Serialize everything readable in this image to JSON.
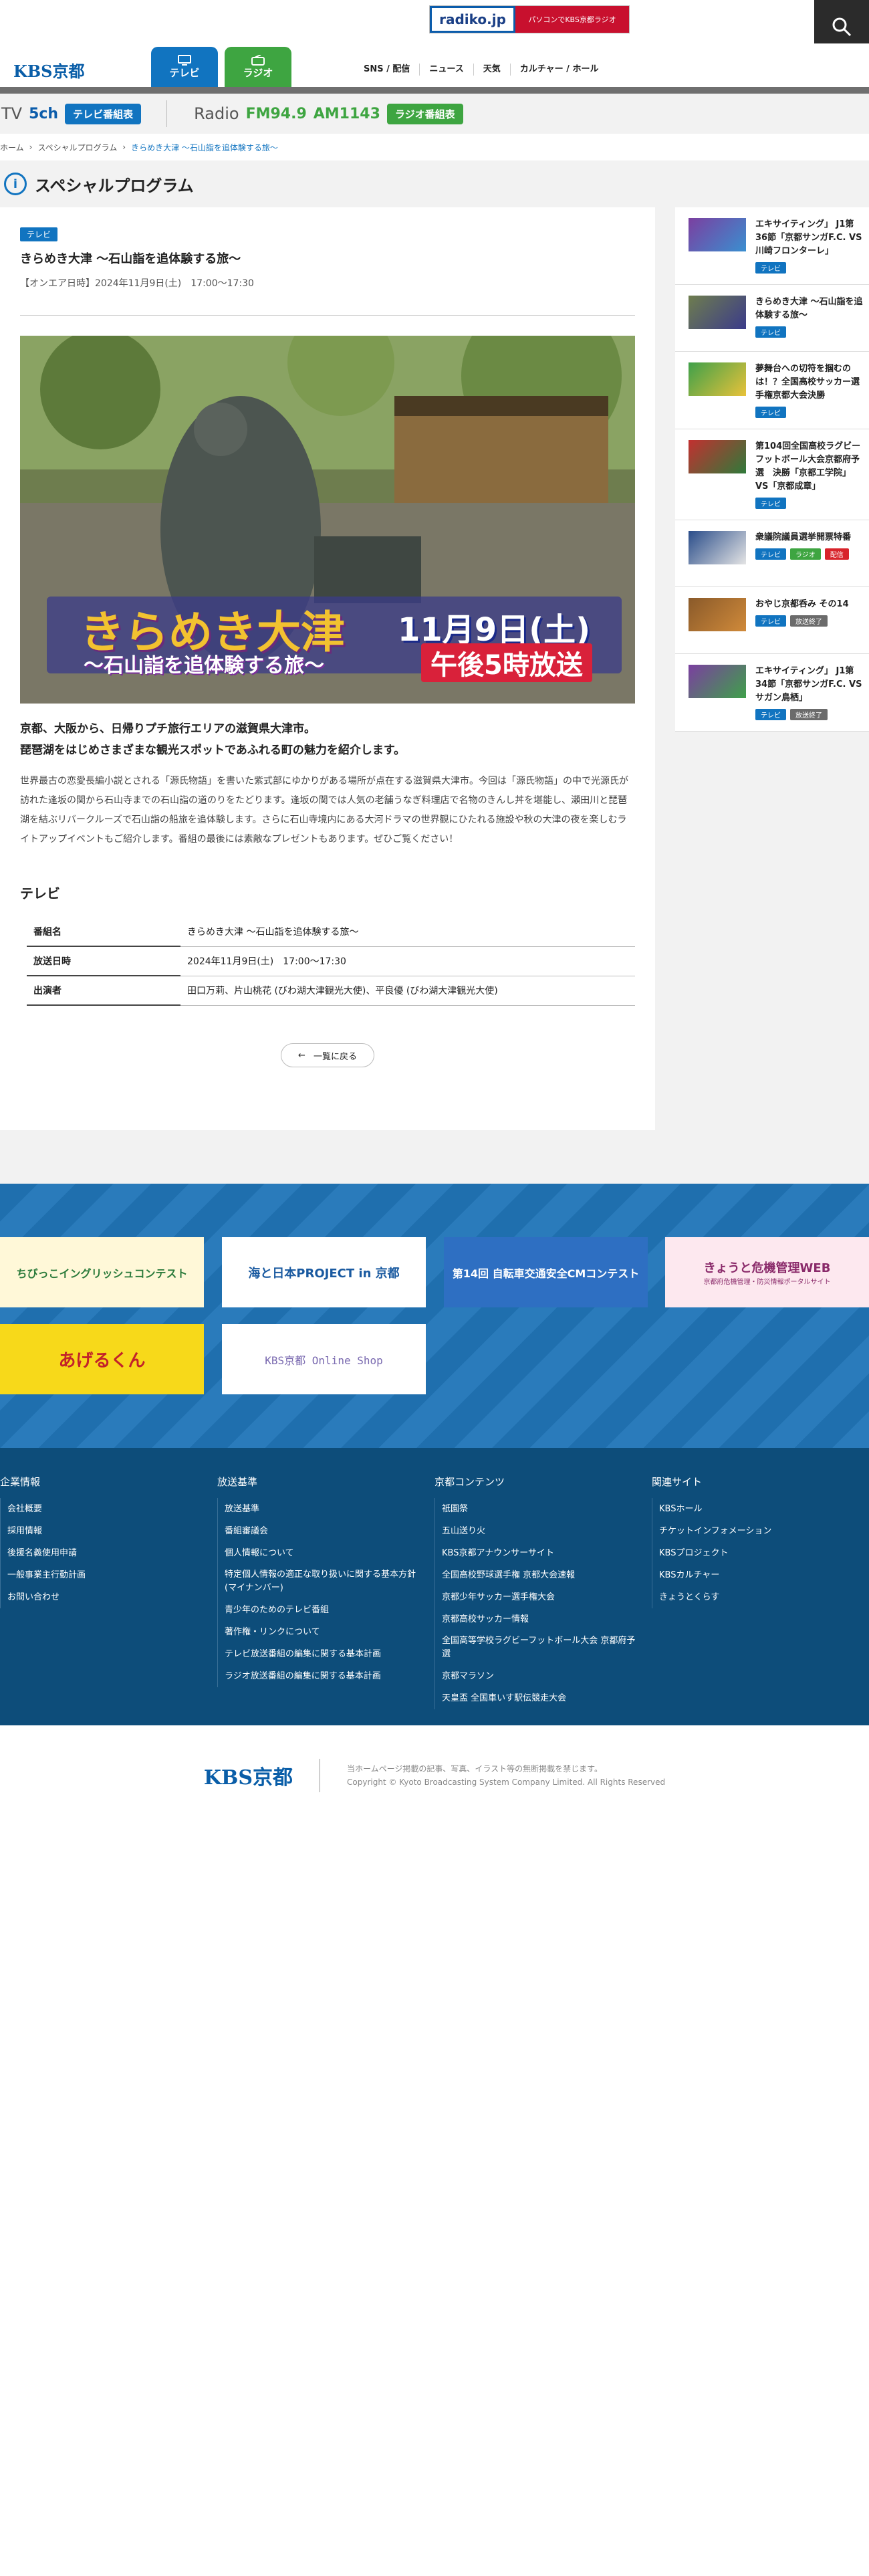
{
  "topbar": {
    "radiko_logo": "radiko.jp",
    "radiko_text": "パソコンでKBS京都ラジオ"
  },
  "header": {
    "logo": "KBS京都",
    "tab_tv": "テレビ",
    "tab_radio": "ラジオ",
    "nav": [
      "SNS / 配信",
      "ニュース",
      "天気",
      "カルチャー / ホール"
    ]
  },
  "channels": {
    "tv_label": "TV",
    "tv_ch": "5ch",
    "tv_button": "テレビ番組表",
    "radio_label": "Radio",
    "fm": "FM94.9",
    "am": "AM1143",
    "radio_button": "ラジオ番組表"
  },
  "breadcrumb": {
    "home": "ホーム",
    "section": "スペシャルプログラム",
    "current": "きらめき大津 〜石山詣を追体験する旅〜"
  },
  "page_title": "スペシャルプログラム",
  "article": {
    "badge": "テレビ",
    "title": "きらめき大津 〜石山詣を追体験する旅〜",
    "date": "【オンエア日時】2024年11月9日(土)　17:00〜17:30",
    "hero_title": "きらめき大津",
    "hero_sub": "〜石山詣を追体験する旅〜",
    "hero_date": "11月9日(土)",
    "hero_time": "午後5時放送",
    "lead1": "京都、大阪から、日帰りプチ旅行エリアの滋賀県大津市。",
    "lead2": "琵琶湖をはじめさまざまな観光スポットであふれる町の魅力を紹介します。",
    "body": "世界最古の恋愛長編小説とされる「源氏物語」を書いた紫式部にゆかりがある場所が点在する滋賀県大津市。今回は「源氏物語」の中で光源氏が訪れた逢坂の関から石山寺までの石山詣の道のりをたどります。逢坂の関では人気の老舗うなぎ料理店で名物のきんし丼を堪能し、瀬田川と琵琶湖を結ぶリバークルーズで石山詣の船旅を追体験します。さらに石山寺境内にある大河ドラマの世界観にひたれる施設や秋の大津の夜を楽しむライトアップイベントもご紹介します。番組の最後には素敵なプレゼントもあります。ぜひご覧ください！",
    "table_title": "テレビ",
    "rows": [
      {
        "k": "番組名",
        "v": "きらめき大津 〜石山詣を追体験する旅〜"
      },
      {
        "k": "放送日時",
        "v": "2024年11月9日(土)　17:00〜17:30"
      },
      {
        "k": "出演者",
        "v": "田口万莉、片山桃花 (びわ湖大津観光大使)、平良優 (びわ湖大津観光大使)"
      }
    ],
    "back": "一覧に戻る"
  },
  "sidebar": [
    {
      "title": "エキサイティング」 J1第36節「京都サンガF.C. VS 川崎フロンターレ」",
      "tags": [
        "テレビ"
      ]
    },
    {
      "title": "きらめき大津 〜石山詣を追体験する旅〜",
      "tags": [
        "テレビ"
      ]
    },
    {
      "title": "夢舞台への切符を掴むのは！？全国高校サッカー選手権京都大会決勝",
      "tags": [
        "テレビ"
      ]
    },
    {
      "title": "第104回全国高校ラグビーフットボール大会京都府予選　決勝「京都工学院」VS「京都成章」",
      "tags": [
        "テレビ"
      ]
    },
    {
      "title": "衆議院議員選挙開票特番",
      "tags": [
        "テレビ",
        "ラジオ",
        "配信"
      ]
    },
    {
      "title": "おやじ京都呑み その14",
      "tags": [
        "テレビ",
        "放送終了"
      ]
    },
    {
      "title": "エキサイティング」 J1第34節「京都サンガF.C. VS サガン鳥栖」",
      "tags": [
        "テレビ",
        "放送終了"
      ]
    }
  ],
  "banners": [
    "ちびっこイングリッシュコンテスト",
    "海と日本PROJECT in 京都",
    "第14回 自転車交通安全CMコンテスト",
    "きょうと危機管理WEB",
    "京都府危機管理・防災情報ポータルサイト",
    "あげるくん",
    "KBS京都 Online Shop"
  ],
  "footer": [
    {
      "title": "企業情報",
      "items": [
        "会社概要",
        "採用情報",
        "後援名義使用申請",
        "一般事業主行動計画",
        "お問い合わせ"
      ]
    },
    {
      "title": "放送基準",
      "items": [
        "放送基準",
        "番組審議会",
        "個人情報について",
        "特定個人情報の適正な取り扱いに関する基本方針(マイナンバー)",
        "青少年のためのテレビ番組",
        "著作権・リンクについて",
        "テレビ放送番組の編集に関する基本計画",
        "ラジオ放送番組の編集に関する基本計画"
      ]
    },
    {
      "title": "京都コンテンツ",
      "items": [
        "祇園祭",
        "五山送り火",
        "KBS京都アナウンサーサイト",
        "全国高校野球選手権 京都大会速報",
        "京都少年サッカー選手権大会",
        "京都高校サッカー情報",
        "全国高等学校ラグビーフットボール大会 京都府予選",
        "京都マラソン",
        "天皇盃 全国車いす駅伝競走大会"
      ]
    },
    {
      "title": "関連サイト",
      "items": [
        "KBSホール",
        "チケットインフォメーション",
        "KBSプロジェクト",
        "KBSカルチャー",
        "きょうとくらす"
      ]
    }
  ],
  "bottom": {
    "logo": "KBS京都",
    "text1": "当ホームページ掲載の記事、写真、イラスト等の無断掲載を禁じます。",
    "text2": "Copyright © Kyoto Broadcasting System Company Limited. All Rights Reserved"
  }
}
